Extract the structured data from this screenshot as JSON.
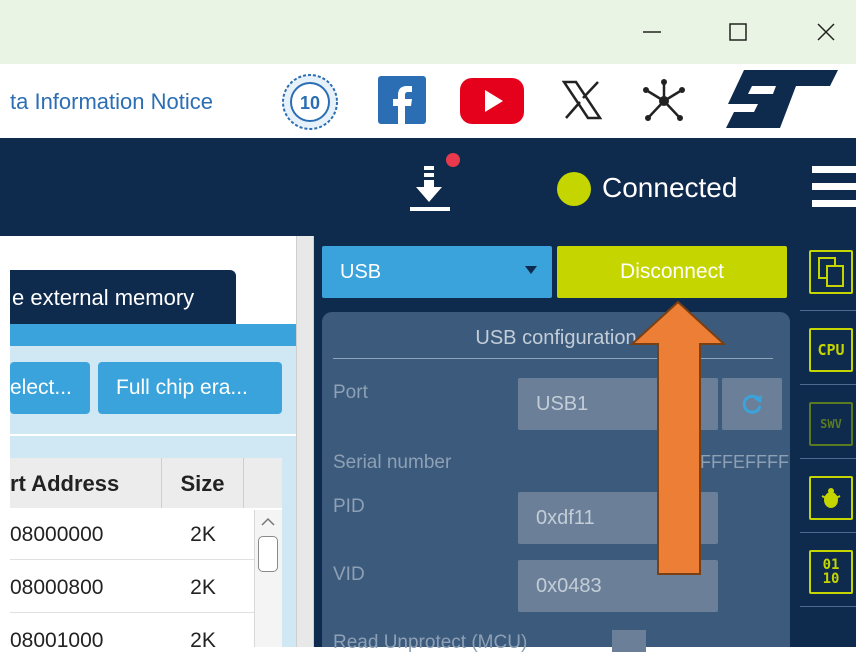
{
  "titlebar": {
    "minimize_icon": "minimize-icon",
    "maximize_icon": "maximize-icon",
    "close_icon": "close-icon"
  },
  "banner": {
    "notice_text": "ta Information Notice",
    "badge_text": "10",
    "icons": [
      "anniversary-badge-icon",
      "facebook-icon",
      "youtube-icon",
      "x-icon",
      "network-icon",
      "st-logo-icon"
    ]
  },
  "header": {
    "status_text": "Connected",
    "status_color": "#c4d500",
    "download_icon": "download-notification-icon"
  },
  "left_panel": {
    "tab_label": "e external memory",
    "buttons": [
      {
        "label": "elect..."
      },
      {
        "label": "Full chip era..."
      }
    ],
    "table": {
      "headers": [
        "rt Address",
        "Size"
      ],
      "rows": [
        {
          "address": "08000000",
          "size": "2K"
        },
        {
          "address": "08000800",
          "size": "2K"
        },
        {
          "address": "08001000",
          "size": "2K"
        }
      ]
    }
  },
  "connection": {
    "interface_selected": "USB",
    "disconnect_label": "Disconnect",
    "config_title": "USB configuration",
    "port_label": "Port",
    "port_value": "USB1",
    "serial_label": "Serial number",
    "serial_value": "FFFEFFFF",
    "pid_label": "PID",
    "pid_value": "0xdf11",
    "vid_label": "VID",
    "vid_value": "0x0483",
    "read_unprotect_label": "Read Unprotect (MCU)"
  },
  "sidebar": {
    "icons": [
      {
        "name": "memory-copy-icon",
        "text": ""
      },
      {
        "name": "cpu-icon",
        "text": "CPU"
      },
      {
        "name": "swv-icon",
        "text": "SWV"
      },
      {
        "name": "bug-icon",
        "text": ""
      },
      {
        "name": "binary-icon",
        "text": "01\n10"
      }
    ]
  },
  "colors": {
    "navy": "#0e2a4d",
    "accent_green": "#c4d500",
    "accent_blue": "#3aa3dc",
    "arrow_orange": "#ec7f35"
  }
}
